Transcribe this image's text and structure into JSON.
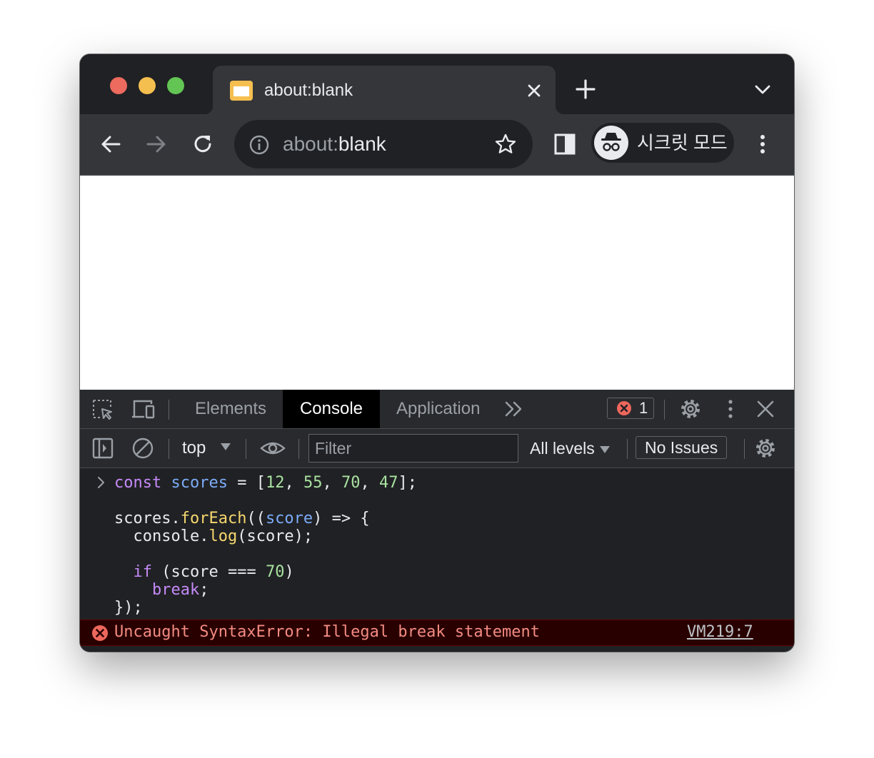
{
  "browser": {
    "tab": {
      "title": "about:blank",
      "favicon_icon": "page-icon",
      "close_icon": "close-icon"
    },
    "new_tab_icon": "plus-icon",
    "tab_search_icon": "chevron-down-icon",
    "toolbar": {
      "back_icon": "arrow-left-icon",
      "forward_icon": "arrow-right-icon",
      "reload_icon": "reload-icon",
      "omnibox": {
        "scheme": "about:",
        "path": "blank",
        "info_icon": "info-icon",
        "bookmark_icon": "star-icon"
      },
      "side_panel_icon": "side-panel-icon",
      "incognito": {
        "label": "시크릿 모드",
        "icon": "incognito-icon"
      },
      "menu_icon": "kebab-menu-icon"
    }
  },
  "devtools": {
    "tabs": [
      {
        "label": "Elements",
        "active": false
      },
      {
        "label": "Console",
        "active": true
      },
      {
        "label": "Application",
        "active": false
      }
    ],
    "more_tabs_icon": "double-chevron-icon",
    "error_count": "1",
    "toolbar": {
      "context": "top",
      "filter_placeholder": "Filter",
      "levels": "All levels",
      "issues": "No Issues"
    },
    "console": {
      "error": {
        "message": "Uncaught SyntaxError: Illegal break statement",
        "source": "VM219:7"
      }
    },
    "colors": {
      "keyword": "#c58af9",
      "variable": "#7cacf8",
      "number": "#a8e2a0",
      "function": "#f5d76e",
      "error_text": "#f28b82",
      "error_bg": "#290000"
    }
  }
}
